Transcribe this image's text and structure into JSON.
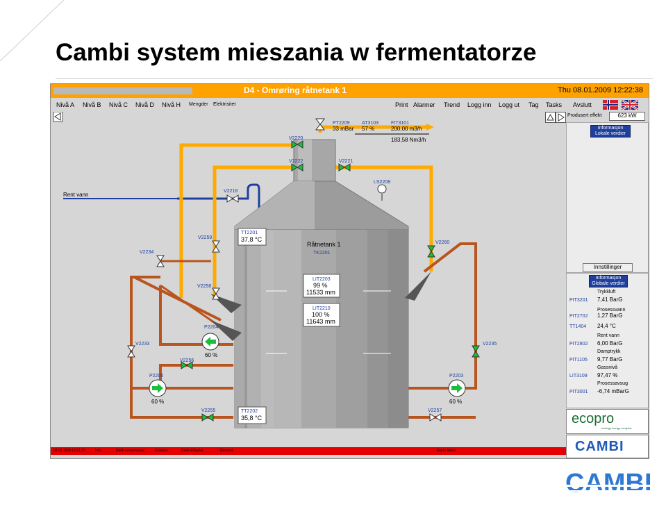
{
  "slide": {
    "title": "Cambi system mieszania w fermentatorze"
  },
  "header": {
    "title": "D4 - Omrøring råtnetank 1",
    "datetime": "Thu 08.01.2009 12:22:38"
  },
  "menu": {
    "items": [
      "Nivå A",
      "Nivå B",
      "Nivå C",
      "Nivå D",
      "Nivå H",
      "Mengder",
      "Elektrisitet"
    ],
    "right_items": [
      "Print",
      "Alarmer",
      "Trend",
      "Logg inn",
      "Logg ut",
      "Tag",
      "Tasks",
      "Avslutt"
    ]
  },
  "toolbar": {
    "produced_label": "Produsert effekt",
    "produced_value": "623 kW"
  },
  "colors": {
    "header": "#ffa200",
    "pipe_orange": "#ffaa00",
    "pipe_brown": "#b8541e",
    "water_blue": "#1f3fa0",
    "pump_green": "#1bbd3d",
    "status_red": "#e40000"
  },
  "side": {
    "info_local": [
      "Informasjon",
      "Lokale verdier"
    ],
    "settings_button": "Innstillinger",
    "info_global": [
      "Informasjon",
      "Globale verdier"
    ],
    "globals": [
      {
        "name": "Trykkluft",
        "tag": "PIT3201",
        "value": "7,41 BarG"
      },
      {
        "name": "Prosessvann",
        "tag": "PIT2702",
        "value": "1,27 BarG"
      },
      {
        "name": "",
        "tag": "TT1404",
        "value": "24,4 °C"
      },
      {
        "name": "Rent vann",
        "tag": "PIT2802",
        "value": "6,00 BarG"
      },
      {
        "name": "Damptrykk",
        "tag": "PIT1105",
        "value": "9,77 BarG"
      },
      {
        "name": "Gassnivå",
        "tag": "LIT3109",
        "value": "97,47 %"
      },
      {
        "name": "Prosessavsug",
        "tag": "PIT3001",
        "value": "-6,74 mBarG"
      }
    ],
    "ecopro": {
      "name": "ecopro",
      "tagline": "ecology  energy  compost"
    },
    "cambi": "CAMBI"
  },
  "process": {
    "rent_vann": "Rent vann",
    "tank_name": "Råtnetank 1",
    "tank_tag": "TK2201",
    "top_instruments": [
      {
        "tag": "PT2209",
        "value": "33 mBar"
      },
      {
        "tag": "AT3103",
        "value": "57 %"
      },
      {
        "tag": "FIT3101",
        "value": "200,00 m3/h"
      }
    ],
    "flow_nm3": "183,58 Nm3/h",
    "ls_tag": "LS2208",
    "tt2201": {
      "tag": "TT2201",
      "value": "37,8 °C"
    },
    "tt2202": {
      "tag": "TT2202",
      "value": "35,8 °C"
    },
    "lit2203": {
      "tag": "LIT2203",
      "pct": "99 %",
      "mm": "11533 mm"
    },
    "lit2210": {
      "tag": "LIT2210",
      "pct": "100 %",
      "mm": "11643 mm"
    },
    "valves": [
      "V2220",
      "V2222",
      "V2221",
      "V2218",
      "V2259",
      "V2234",
      "V2258",
      "V2260",
      "V2233",
      "V2256",
      "V2235",
      "V2255",
      "V2257"
    ],
    "pumps": [
      {
        "tag": "P2204",
        "value": "60 %"
      },
      {
        "tag": "P2205",
        "value": "60 %"
      },
      {
        "tag": "P2203",
        "value": "60 %"
      }
    ]
  },
  "statusbar": [
    "08.01.2009 12:21:25",
    "Info",
    "Dekk semiprosess",
    "Ekstemt",
    "Dekk luftkjøler",
    "Ekstemt",
    "Alarm Alarm"
  ],
  "logo": "CAMBI"
}
